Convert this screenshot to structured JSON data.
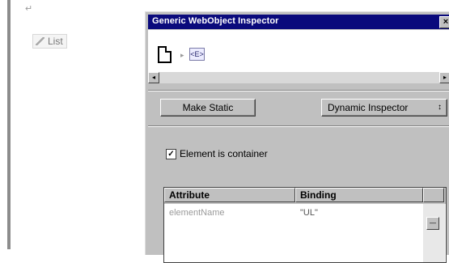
{
  "editor": {
    "paragraph_mark": "↵",
    "list_element_label": "List"
  },
  "inspector": {
    "title": "Generic WebObject Inspector",
    "close_glyph": "×",
    "path": {
      "separator": "▸",
      "element_glyph": "<E>"
    },
    "scroll": {
      "left_arrow": "◂",
      "right_arrow": "▸"
    },
    "make_static_label": "Make Static",
    "dynamic_inspector_label": "Dynamic Inspector",
    "dynamic_inspector_chevron": "↕",
    "container_checkbox": {
      "label": "Element is container",
      "checked": true,
      "mark": "✓"
    },
    "table": {
      "headers": [
        "Attribute",
        "Binding"
      ],
      "rows": [
        {
          "attribute": "elementName",
          "binding": "\"UL\""
        }
      ],
      "scroll_thumb": "—"
    }
  },
  "colors": {
    "titlebar": "#0a0a7c",
    "window_bg": "#c0c0c0"
  },
  "icons": [
    "document-icon",
    "element-icon",
    "close-icon",
    "checkbox-icon"
  ]
}
